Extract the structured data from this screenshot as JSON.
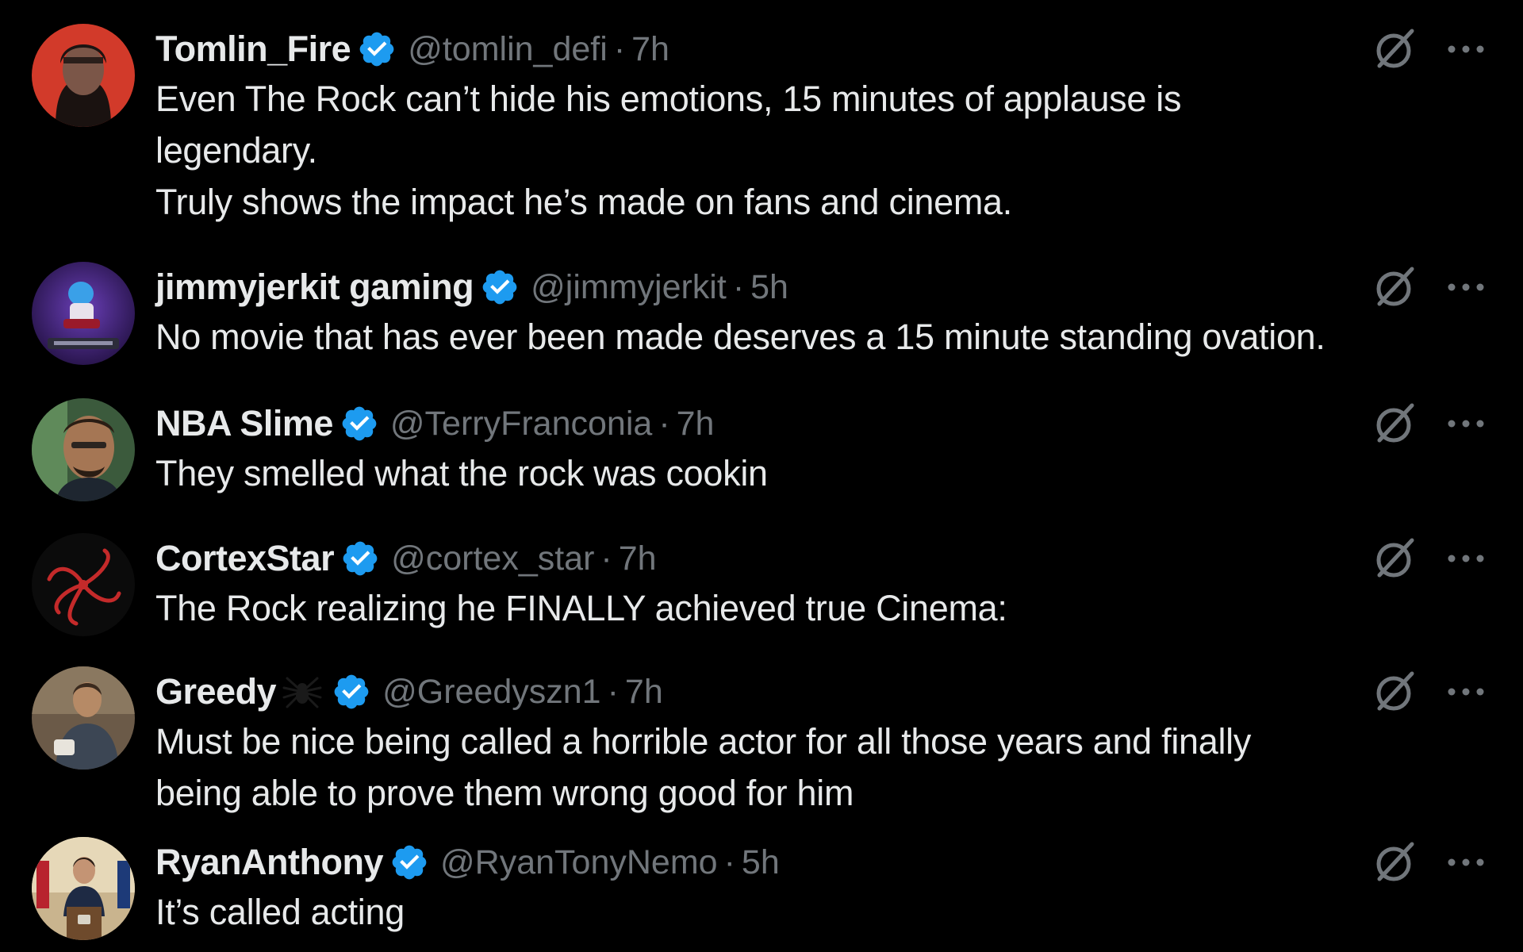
{
  "tweets": [
    {
      "name": "Tomlin_Fire",
      "handle": "@tomlin_defi",
      "separator": "·",
      "time": "7h",
      "text": "Even The Rock can’t hide his emotions, 15 minutes of applause is\nlegendary.\nTruly shows the impact he’s made on fans and cinema.",
      "avatar_icon": "red-portrait-avatar",
      "verified": true
    },
    {
      "name": "jimmyjerkit gaming",
      "handle": "@jimmyjerkit",
      "separator": "·",
      "time": "5h",
      "text": "No movie that has ever been made deserves a 15 minute standing ovation.",
      "avatar_icon": "purple-gaming-avatar",
      "verified": true
    },
    {
      "name": "NBA Slime",
      "handle": "@TerryFranconia",
      "separator": "·",
      "time": "7h",
      "text": "They smelled what the rock was cookin",
      "avatar_icon": "face-photo-avatar",
      "verified": true
    },
    {
      "name": "CortexStar",
      "handle": "@cortex_star",
      "separator": "·",
      "time": "7h",
      "text": "The Rock realizing he FINALLY achieved true Cinema:",
      "avatar_icon": "red-swirl-avatar",
      "verified": true
    },
    {
      "name": "Greedy",
      "name_emoji": "spider-icon",
      "handle": "@Greedyszn1",
      "separator": "·",
      "time": "7h",
      "text": "Must be nice being called a horrible actor for all those years and finally\nbeing able to prove them wrong good for him",
      "avatar_icon": "person-photo-avatar",
      "verified": true
    },
    {
      "name": "RyanAnthony",
      "handle": "@RyanTonyNemo",
      "separator": "·",
      "time": "5h",
      "text": "It’s called acting",
      "avatar_icon": "podium-photo-avatar",
      "verified": true
    }
  ],
  "icons": {
    "grok": "grok-icon",
    "more": "more-options-icon",
    "verified": "verified-badge-icon"
  },
  "colors": {
    "background": "#000000",
    "text": "#e7e9ea",
    "secondary": "#71767b",
    "verified": "#1d9bf0"
  }
}
